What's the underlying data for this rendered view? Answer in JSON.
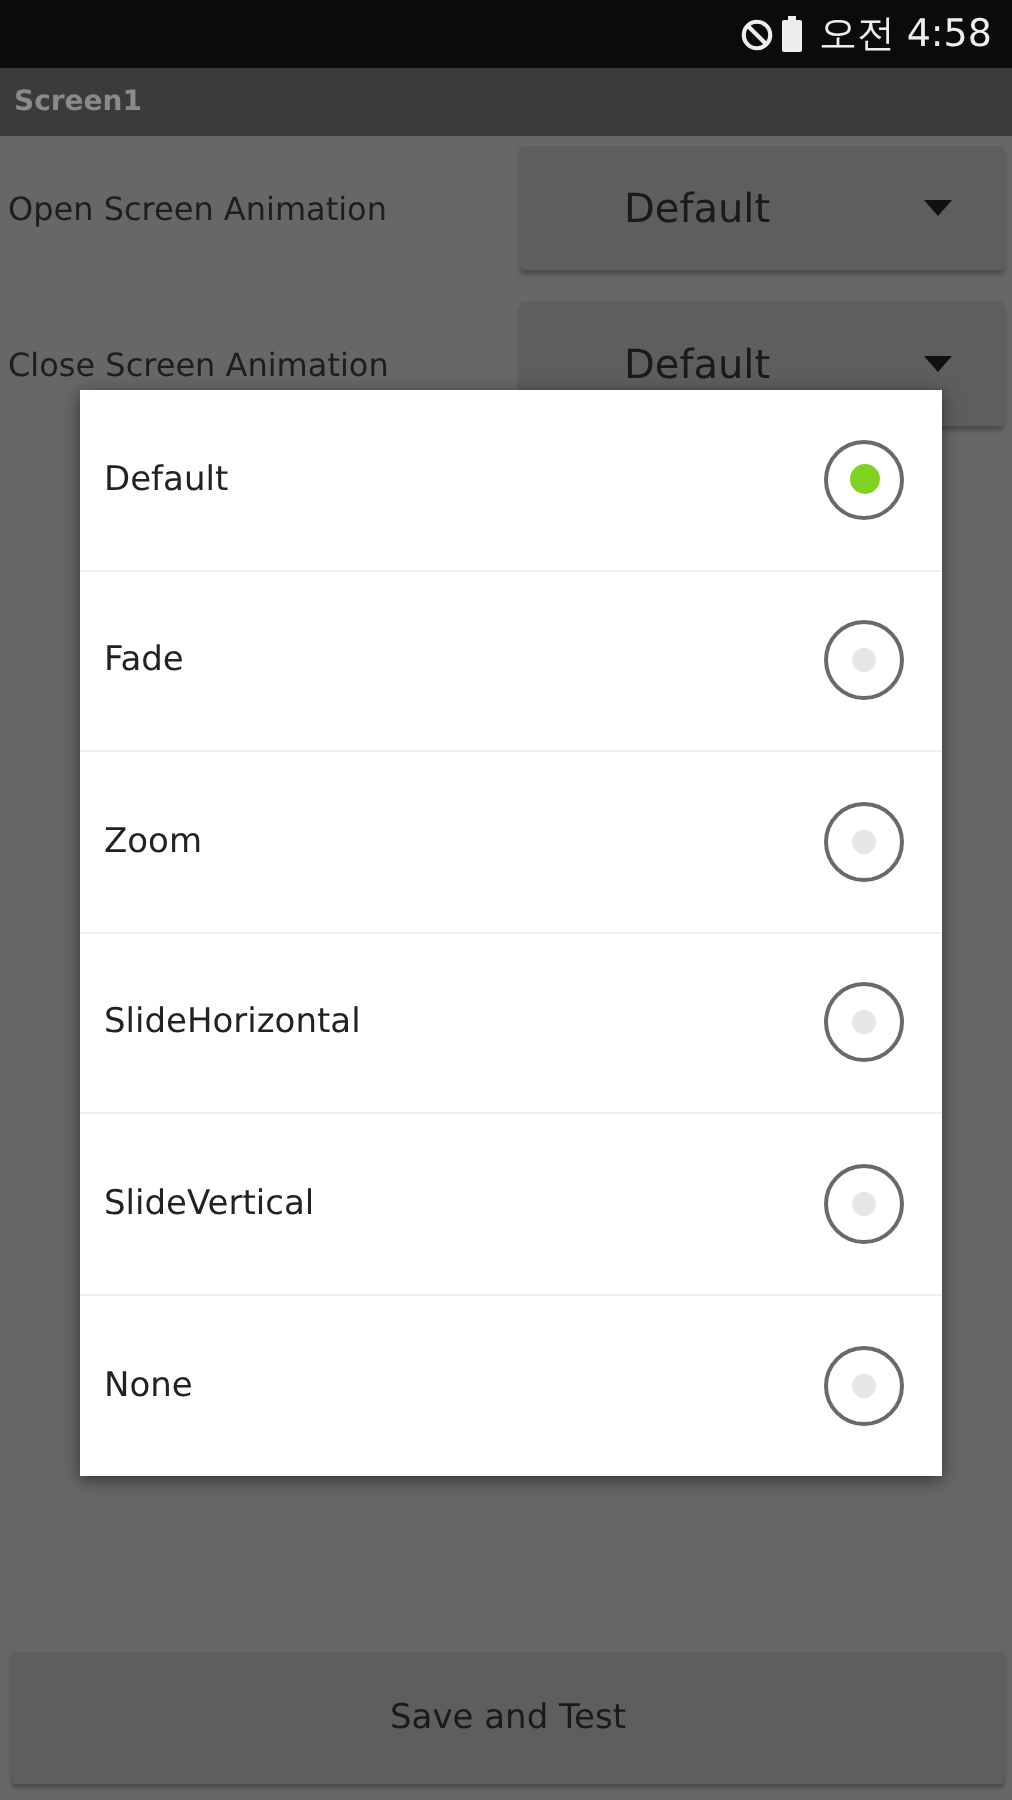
{
  "status_bar": {
    "time": "오전 4:58"
  },
  "title_bar": {
    "title": "Screen1"
  },
  "settings": [
    {
      "label": "Open Screen Animation",
      "value": "Default"
    },
    {
      "label": "Close Screen Animation",
      "value": "Default"
    }
  ],
  "dialog": {
    "options": [
      {
        "label": "Default",
        "selected": true
      },
      {
        "label": "Fade",
        "selected": false
      },
      {
        "label": "Zoom",
        "selected": false
      },
      {
        "label": "SlideHorizontal",
        "selected": false
      },
      {
        "label": "SlideVertical",
        "selected": false
      },
      {
        "label": "None",
        "selected": false
      }
    ]
  },
  "button": {
    "label": "Save and Test"
  }
}
